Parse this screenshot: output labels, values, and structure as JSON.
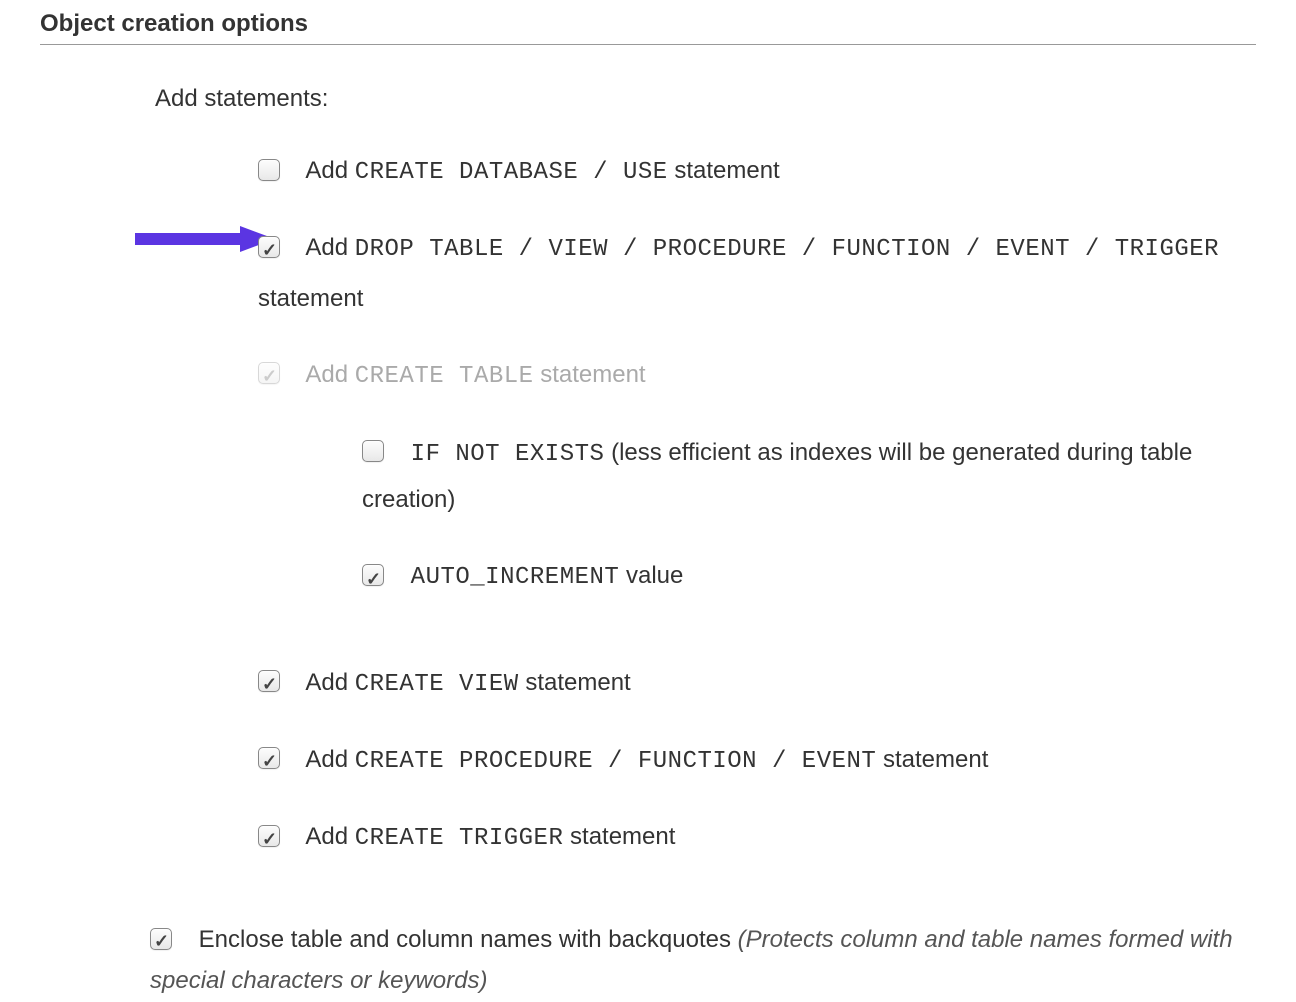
{
  "section_title": "Object creation options",
  "add_statements_label": "Add statements:",
  "items": {
    "create_database": {
      "checked": false,
      "pre": "Add ",
      "code": "CREATE DATABASE / USE",
      "post": " statement"
    },
    "drop_table": {
      "checked": true,
      "pre": "Add ",
      "code": "DROP TABLE / VIEW / PROCEDURE / FUNCTION / EVENT / TRIGGER",
      "post_line2": "statement"
    },
    "create_table": {
      "checked": true,
      "disabled": true,
      "pre": "Add ",
      "code": "CREATE TABLE",
      "post": " statement"
    },
    "if_not_exists": {
      "checked": false,
      "code": "IF NOT EXISTS",
      "post": " (less efficient as indexes will be generated during table creation)"
    },
    "auto_increment": {
      "checked": true,
      "code": "AUTO_INCREMENT",
      "post": " value"
    },
    "create_view": {
      "checked": true,
      "pre": "Add ",
      "code": "CREATE VIEW",
      "post": " statement"
    },
    "create_procedure": {
      "checked": true,
      "pre": "Add ",
      "code": "CREATE PROCEDURE / FUNCTION / EVENT",
      "post": " statement"
    },
    "create_trigger": {
      "checked": true,
      "pre": "Add ",
      "code": "CREATE TRIGGER",
      "post": " statement"
    },
    "enclose": {
      "checked": true,
      "text": "Enclose table and column names with backquotes ",
      "italic": "(Protects column and table names formed with special characters or keywords)"
    }
  },
  "colors": {
    "arrow": "#5B35E2"
  }
}
